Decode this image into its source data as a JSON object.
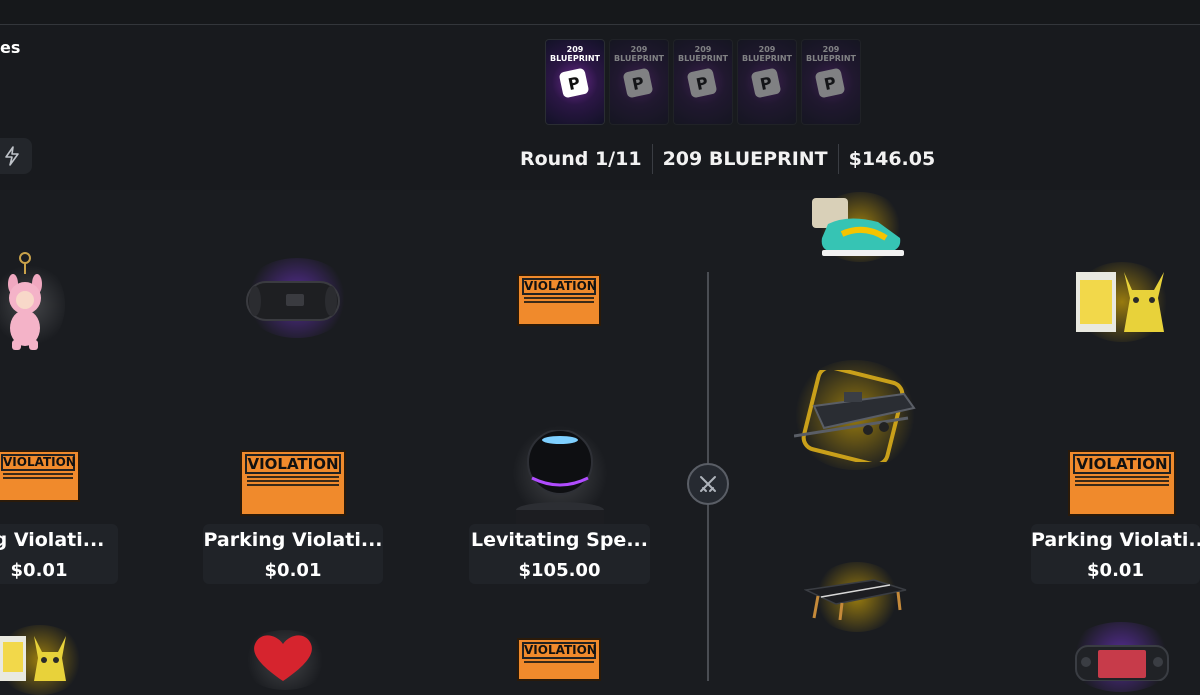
{
  "header": {
    "left_partial_title": "es",
    "round": "Round 1/11",
    "pack_name": "209 BLUEPRINT",
    "total": "$146.05"
  },
  "packs": [
    {
      "title": "209 BLUEPRINT",
      "logo": "P",
      "active": true
    },
    {
      "title": "209 BLUEPRINT",
      "logo": "P",
      "active": false
    },
    {
      "title": "209 BLUEPRINT",
      "logo": "P",
      "active": false
    },
    {
      "title": "209 BLUEPRINT",
      "logo": "P",
      "active": false
    },
    {
      "title": "209 BLUEPRINT",
      "logo": "P",
      "active": false
    }
  ],
  "violation_sign": {
    "title": "VIOLATION"
  },
  "cards": [
    {
      "name": "ing Violati...",
      "price": "$0.01"
    },
    {
      "name": "Parking Violati...",
      "price": "$0.01"
    },
    {
      "name": "Levitating Spe...",
      "price": "$105.00"
    },
    {
      "name": "Parking Violati...",
      "price": "$0.01"
    }
  ],
  "icons": {
    "bolt": "bolt-icon",
    "vs": "swords-icon",
    "accent_gold": "#f5c400",
    "accent_purple": "#8c3cff",
    "violation_orange": "#f08a2c"
  }
}
